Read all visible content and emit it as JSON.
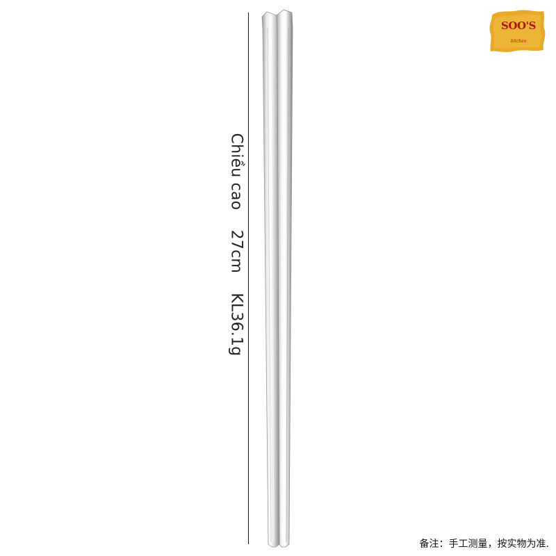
{
  "dimension": {
    "label_height": "Chiều cao",
    "label_length": "27cm",
    "label_weight": "KL36.1g"
  },
  "logo": {
    "name": "SOO'S",
    "sub": "kitchen"
  },
  "note": "备注：手工测量，按实物为准.",
  "colors": {
    "background": "#ffffff",
    "steel_light": "#f2f2f2",
    "steel_dark": "#8a8a8a",
    "logo_bg": "#e8a92a",
    "logo_text": "#b31212"
  }
}
